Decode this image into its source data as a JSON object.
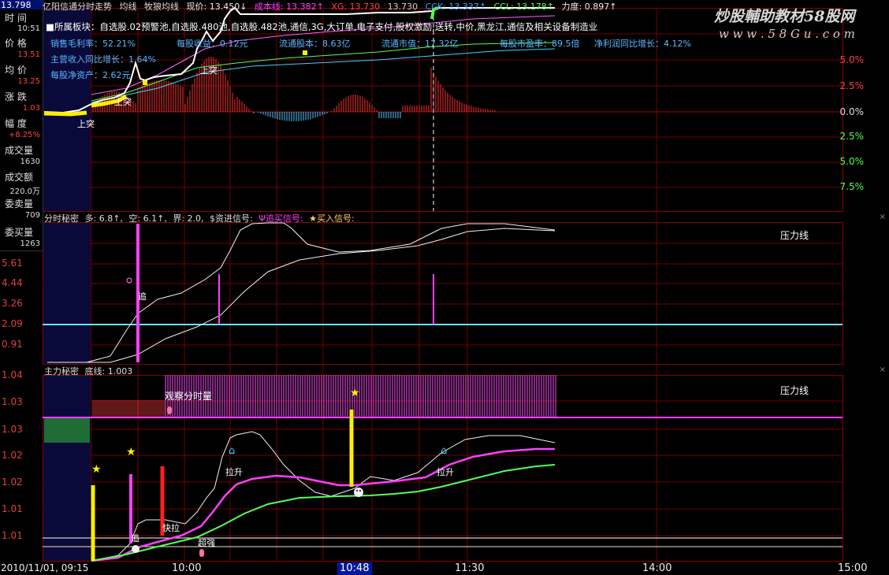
{
  "header": {
    "price": "13.798",
    "title": "亿阳信通分时走势",
    "avg_label": "均线",
    "ma_label": "牧狼均线",
    "now_price": "现价: 13.450↓",
    "cost": "成本线: 13.382↑",
    "xg": "XG: 13.730",
    "v13730": "13.730",
    "cck": "CCK: 13.337↑",
    "ccl": "CCL: 13.178↑",
    "power": "力度: 0.897↑"
  },
  "info_panel": {
    "time_label": "时  间",
    "time_value": "10:51",
    "price_label": "价  格",
    "price_value": "13.51",
    "avg_label": "均  价",
    "avg_value": "13.25",
    "chg_label": "涨  跌",
    "chg_value": "1.03",
    "amp_label": "幅  度",
    "amp_value": "+8.25%",
    "vol_label": "成交量",
    "vol_value": "1630",
    "amt_label": "成交额",
    "amt_value": "220.0万",
    "ask_label": "委卖量",
    "ask_value": "709",
    "bid_label": "委买量",
    "bid_value": "1263"
  },
  "fundamentals": {
    "sector": "■所属板块：自选股.02预警池,自选股.480池,自选股.482池,通信,3G,大订单,电子支付,股权激励,送转,中价,黑龙江,通信及相关设备制造业",
    "gross": "销售毛利率：52.21%",
    "eps": "每股收益：0.12元",
    "float_shares": "流通股本：8.63亿",
    "float_mv": "流通市值：17.32亿",
    "pe": "每股市盈率：89.5倍",
    "net_growth": "净利润同比增长：4.12%",
    "rev_growth": "主营收入同比增长：1.64%",
    "nav": "每股净资产：2.62元"
  },
  "main_chart": {
    "right_ticks": [
      "5.0%",
      "2.5%",
      "0.0%",
      "2.5%",
      "5.0%",
      "7.5%"
    ],
    "signals": [
      "上突",
      "上突",
      "上突"
    ]
  },
  "panel2": {
    "legend_title": "分时秘密",
    "legend_duo": "多: 6.8↑,",
    "legend_kong": "空: 6.1↑,",
    "legend_jie": "界: 2.0,",
    "legend_fund": "$资进信号:",
    "legend_chase": "Ψ追买信号:",
    "legend_buy": "★买入信号:",
    "pressure": "压力线",
    "chase": "追",
    "ticks": [
      "5.61",
      "4.44",
      "3.26",
      "2.09",
      "0.91"
    ]
  },
  "panel3": {
    "legend_title": "主力秘密",
    "legend_base": "底线: 1.003",
    "pressure": "压力线",
    "observe": "观察分时量",
    "labels": {
      "lashen1": "拉升",
      "lashen2": "拉升",
      "kuaila": "快拉",
      "chaoqiang": "超强",
      "zhui": "追"
    },
    "ticks": [
      "1.04",
      "1.03",
      "1.03",
      "1.02",
      "1.02",
      "1.01",
      "1.01"
    ]
  },
  "x_axis": {
    "start": "2010/11/01, 09:15",
    "t1000": "10:00",
    "cursor": "10:48",
    "t1130": "11:30",
    "t1400": "14:00",
    "t1500": "15:00"
  },
  "watermark": {
    "brand": "炒股輔助教材58股网",
    "url": "w w w . 5 8 G u . c o m"
  },
  "colors": {
    "grid": "#7a0000",
    "up": "#ff3030",
    "down": "#4fc8ff",
    "magenta": "#ff40ff",
    "cyan": "#60d8ff",
    "yellow": "#ffee00"
  }
}
